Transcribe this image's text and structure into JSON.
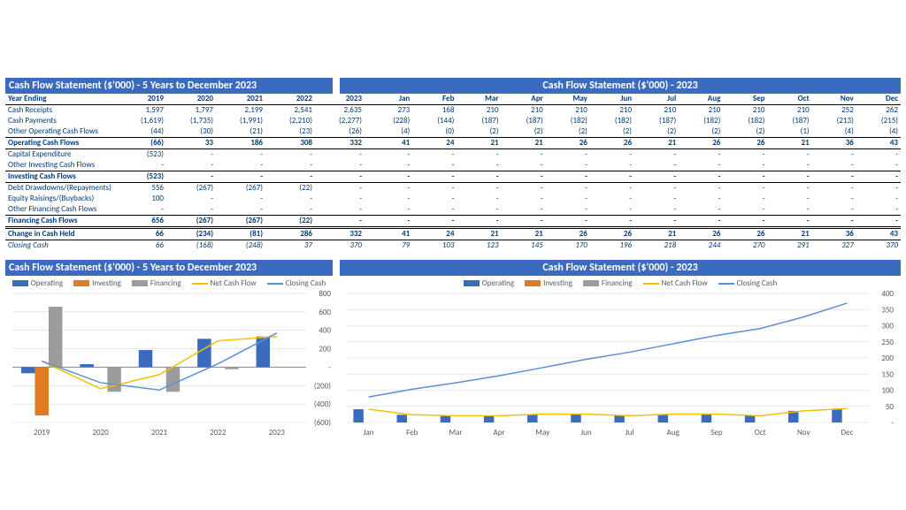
{
  "titles": {
    "t1": "Cash Flow Statement ($'000) - 5 Years to December 2023",
    "t2": "Cash Flow Statement ($'000) - 2023",
    "t3": "Cash Flow Statement ($'000) - 5 Years to December 2023",
    "t4": "Cash Flow Statement ($'000) - 2023"
  },
  "rows": {
    "ye": "Year Ending",
    "cr": "Cash Receipts",
    "cp": "Cash Payments",
    "ooc": "Other Operating Cash Flows",
    "ocf": "Operating Cash Flows",
    "ce": "Capital Expenditure",
    "oic": "Other Investing Cash Flows",
    "icf": "Investing Cash Flows",
    "dd": "Debt Drawdowns/(Repayments)",
    "er": "Equity Raisings/(Buybacks)",
    "ofc": "Other Financing Cash Flows",
    "fcf": "Financing Cash Flows",
    "cch": "Change in Cash Held",
    "cc": "Closing Cash"
  },
  "legend": {
    "Operating": "#3b6bbf",
    "Investing": "#e07b1f",
    "Financing": "#9c9c9c",
    "Net Cash Flow": "#f2c200",
    "Closing Cash": "#5b8fd6"
  },
  "yearly": {
    "years": [
      "2019",
      "2020",
      "2021",
      "2022",
      "2023"
    ],
    "cash_receipts": [
      "1,597",
      "1,797",
      "2,199",
      "2,541",
      "2,635"
    ],
    "cash_payments": [
      "(1,619)",
      "(1,735)",
      "(1,991)",
      "(2,210)",
      "(2,277)"
    ],
    "other_operating": [
      "(44)",
      "(30)",
      "(21)",
      "(23)",
      "(26)"
    ],
    "operating": [
      "(66)",
      "33",
      "186",
      "308",
      "332"
    ],
    "capex": [
      "(523)",
      "-",
      "-",
      "-",
      "-"
    ],
    "other_investing": [
      "-",
      "-",
      "-",
      "-",
      "-"
    ],
    "investing": [
      "(523)",
      "-",
      "-",
      "-",
      "-"
    ],
    "debt": [
      "556",
      "(267)",
      "(267)",
      "(22)",
      "-"
    ],
    "equity": [
      "100",
      "-",
      "-",
      "-",
      "-"
    ],
    "other_fin": [
      "-",
      "-",
      "-",
      "-",
      "-"
    ],
    "financing": [
      "656",
      "(267)",
      "(267)",
      "(22)",
      "-"
    ],
    "change": [
      "66",
      "(234)",
      "(81)",
      "286",
      "332"
    ],
    "closing": [
      "66",
      "(168)",
      "(248)",
      "37",
      "370"
    ]
  },
  "monthly": {
    "months": [
      "Jan",
      "Feb",
      "Mar",
      "Apr",
      "May",
      "Jun",
      "Jul",
      "Aug",
      "Sep",
      "Oct",
      "Nov",
      "Dec"
    ],
    "cash_receipts": [
      "273",
      "168",
      "210",
      "210",
      "210",
      "210",
      "210",
      "210",
      "210",
      "210",
      "252",
      "262"
    ],
    "cash_payments": [
      "(228)",
      "(144)",
      "(187)",
      "(187)",
      "(182)",
      "(182)",
      "(187)",
      "(182)",
      "(182)",
      "(187)",
      "(213)",
      "(215)"
    ],
    "other_operating": [
      "(4)",
      "(0)",
      "(2)",
      "(2)",
      "(2)",
      "(2)",
      "(2)",
      "(2)",
      "(2)",
      "(1)",
      "(4)",
      "(4)"
    ],
    "operating": [
      "41",
      "24",
      "21",
      "21",
      "26",
      "26",
      "21",
      "26",
      "26",
      "21",
      "36",
      "43"
    ],
    "capex": [
      "-",
      "-",
      "-",
      "-",
      "-",
      "-",
      "-",
      "-",
      "-",
      "-",
      "-",
      "-"
    ],
    "other_investing": [
      "-",
      "-",
      "-",
      "-",
      "-",
      "-",
      "-",
      "-",
      "-",
      "-",
      "-",
      "-"
    ],
    "investing": [
      "-",
      "-",
      "-",
      "-",
      "-",
      "-",
      "-",
      "-",
      "-",
      "-",
      "-",
      "-"
    ],
    "debt": [
      "-",
      "-",
      "-",
      "-",
      "-",
      "-",
      "-",
      "-",
      "-",
      "-",
      "-",
      "-"
    ],
    "equity": [
      "-",
      "-",
      "-",
      "-",
      "-",
      "-",
      "-",
      "-",
      "-",
      "-",
      "-",
      "-"
    ],
    "other_fin": [
      "-",
      "-",
      "-",
      "-",
      "-",
      "-",
      "-",
      "-",
      "-",
      "-",
      "-",
      "-"
    ],
    "financing": [
      "-",
      "-",
      "-",
      "-",
      "-",
      "-",
      "-",
      "-",
      "-",
      "-",
      "-",
      "-"
    ],
    "change": [
      "41",
      "24",
      "21",
      "21",
      "26",
      "26",
      "21",
      "26",
      "26",
      "21",
      "36",
      "43"
    ],
    "closing": [
      "79",
      "103",
      "123",
      "145",
      "170",
      "196",
      "218",
      "244",
      "270",
      "291",
      "327",
      "370"
    ]
  },
  "chart_data": [
    {
      "id": "yearly",
      "type": "bar+line",
      "title": "Cash Flow Statement ($'000) - 5 Years to December 2023",
      "categories": [
        "2019",
        "2020",
        "2021",
        "2022",
        "2023"
      ],
      "series": [
        {
          "name": "Operating",
          "type": "bar",
          "color": "#3b6bbf",
          "values": [
            -66,
            33,
            186,
            308,
            332
          ]
        },
        {
          "name": "Investing",
          "type": "bar",
          "color": "#e07b1f",
          "values": [
            -523,
            0,
            0,
            0,
            0
          ]
        },
        {
          "name": "Financing",
          "type": "bar",
          "color": "#9c9c9c",
          "values": [
            656,
            -267,
            -267,
            -22,
            0
          ]
        },
        {
          "name": "Net Cash Flow",
          "type": "line",
          "color": "#f2c200",
          "values": [
            66,
            -234,
            -81,
            286,
            332
          ]
        },
        {
          "name": "Closing Cash",
          "type": "line",
          "color": "#5b8fd6",
          "values": [
            66,
            -168,
            -248,
            37,
            370
          ]
        }
      ],
      "ylim": [
        -600,
        800
      ],
      "yticks": [
        -600,
        -400,
        -200,
        0,
        200,
        400,
        600,
        800
      ],
      "ytick_labels": [
        "(600)",
        "(400)",
        "(200)",
        "-",
        "200",
        "400",
        "600",
        "800"
      ]
    },
    {
      "id": "month",
      "type": "bar+line",
      "title": "Cash Flow Statement ($'000) - 2023",
      "categories": [
        "Jan",
        "Feb",
        "Mar",
        "Apr",
        "May",
        "Jun",
        "Jul",
        "Aug",
        "Sep",
        "Oct",
        "Nov",
        "Dec"
      ],
      "series": [
        {
          "name": "Operating",
          "type": "bar",
          "color": "#3b6bbf",
          "values": [
            41,
            24,
            21,
            21,
            26,
            26,
            21,
            26,
            26,
            21,
            36,
            43
          ]
        },
        {
          "name": "Investing",
          "type": "bar",
          "color": "#e07b1f",
          "values": [
            0,
            0,
            0,
            0,
            0,
            0,
            0,
            0,
            0,
            0,
            0,
            0
          ]
        },
        {
          "name": "Financing",
          "type": "bar",
          "color": "#9c9c9c",
          "values": [
            0,
            0,
            0,
            0,
            0,
            0,
            0,
            0,
            0,
            0,
            0,
            0
          ]
        },
        {
          "name": "Net Cash Flow",
          "type": "line",
          "color": "#f2c200",
          "values": [
            41,
            24,
            21,
            21,
            26,
            26,
            21,
            26,
            26,
            21,
            36,
            43
          ]
        },
        {
          "name": "Closing Cash",
          "type": "line",
          "color": "#5b8fd6",
          "values": [
            79,
            103,
            123,
            145,
            170,
            196,
            218,
            244,
            270,
            291,
            327,
            370
          ]
        }
      ],
      "ylim": [
        0,
        400
      ],
      "yticks": [
        0,
        50,
        100,
        150,
        200,
        250,
        300,
        350,
        400
      ],
      "ytick_labels": [
        "-",
        "50",
        "100",
        "150",
        "200",
        "250",
        "300",
        "350",
        "400"
      ]
    }
  ]
}
